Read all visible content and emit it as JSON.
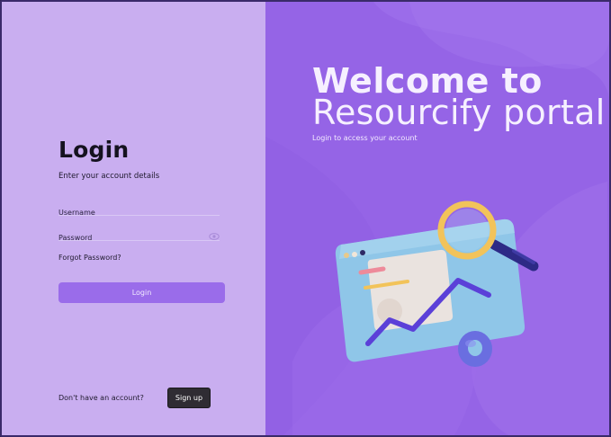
{
  "login": {
    "title": "Login",
    "subtitle": "Enter your account details",
    "username_placeholder": "Username",
    "password_placeholder": "Password",
    "forgot_password": "Forgot Password?",
    "login_button": "Login",
    "no_account": "Don't have an account?",
    "signup_button": "Sign up"
  },
  "hero": {
    "line1": "Welcome to",
    "line2": "Resourcify portal",
    "subtitle": "Login to access your account"
  },
  "icons": {
    "password_toggle": "eye-icon",
    "illustration": "analytics-dashboard-illustration"
  },
  "colors": {
    "left_panel": "#c9aef0",
    "right_panel": "#9564e6",
    "primary_button": "#9a6cea",
    "signup_button": "#2f2c33"
  }
}
